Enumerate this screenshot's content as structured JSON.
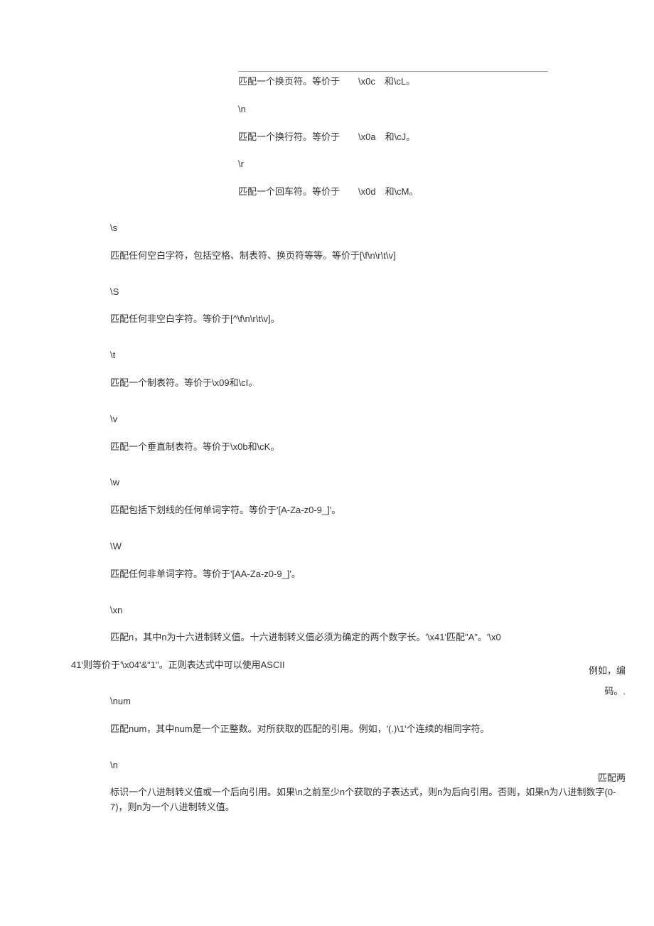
{
  "top_entries": [
    {
      "head": "",
      "desc": "匹配一个换页符。等价于　　\\x0c　和\\cL。"
    },
    {
      "head": "\\n",
      "desc": "匹配一个换行符。等价于　　\\x0a　和\\cJ。"
    },
    {
      "head": "\\r",
      "desc": "匹配一个回车符。等价于　　\\x0d　和\\cM。"
    }
  ],
  "mid_entries": [
    {
      "head": "\\s",
      "desc": "匹配任何空白字符，包括空格、制表符、换页符等等。等价于[\\f\\n\\r\\t\\v]"
    },
    {
      "head": "\\S",
      "desc": "匹配任何非空白字符。等价于[^\\f\\n\\r\\t\\v]。"
    },
    {
      "head": "\\t",
      "desc": "匹配一个制表符。等价于\\x09和\\cI。"
    },
    {
      "head": "\\v",
      "desc": "匹配一个垂直制表符。等价于\\x0b和\\cK。"
    },
    {
      "head": "\\w",
      "desc": "匹配包括下划线的任何单词字符。等价于'[A-Za-z0-9_]'。"
    },
    {
      "head": "\\W",
      "desc": "匹配任何非单词字符。等价于'[AA-Za-z0-9_]'。"
    }
  ],
  "xn": {
    "head": "\\xn",
    "desc_line1": "匹配n，其中n为十六进制转义值。十六进制转义值必须为确定的两个数字长。'\\x41'匹配\"A\"。'\\x0",
    "desc_line2": "41'则等价于'\\x04'&\"1\"。正则表达式中可以使用ASCII",
    "side": "例如，编码。."
  },
  "num_entry": {
    "head": "\\num",
    "desc": "匹配num，其中num是一个正整数。对所获取的匹配的引用。例如，'(.)\\1'个连续的相同字符。",
    "side": "匹配两"
  },
  "n_entry": {
    "head": "\\n",
    "desc": "标识一个八进制转义值或一个后向引用。如果\\n之前至少n个获取的子表达式，则n为后向引用。否则，如果n为八进制数字(0-7)，则n为一个八进制转义值。"
  }
}
